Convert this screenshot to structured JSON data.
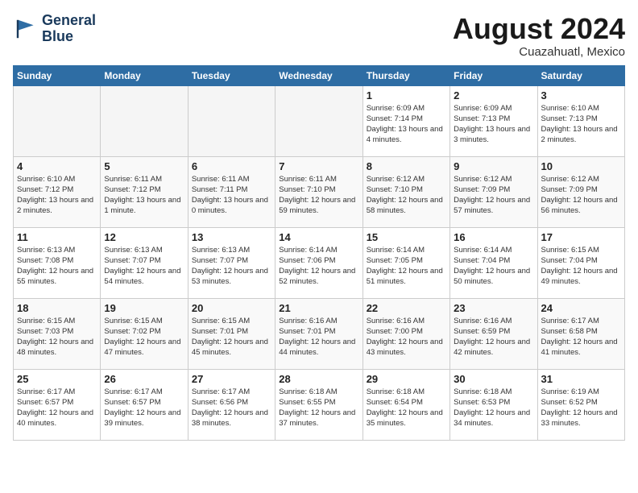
{
  "header": {
    "logo_line1": "General",
    "logo_line2": "Blue",
    "month_year": "August 2024",
    "location": "Cuazahuatl, Mexico"
  },
  "days_of_week": [
    "Sunday",
    "Monday",
    "Tuesday",
    "Wednesday",
    "Thursday",
    "Friday",
    "Saturday"
  ],
  "weeks": [
    [
      {
        "day": "",
        "empty": true
      },
      {
        "day": "",
        "empty": true
      },
      {
        "day": "",
        "empty": true
      },
      {
        "day": "",
        "empty": true
      },
      {
        "day": "1",
        "sunrise": "6:09 AM",
        "sunset": "7:14 PM",
        "daylight": "13 hours and 4 minutes."
      },
      {
        "day": "2",
        "sunrise": "6:09 AM",
        "sunset": "7:13 PM",
        "daylight": "13 hours and 3 minutes."
      },
      {
        "day": "3",
        "sunrise": "6:10 AM",
        "sunset": "7:13 PM",
        "daylight": "13 hours and 2 minutes."
      }
    ],
    [
      {
        "day": "4",
        "sunrise": "6:10 AM",
        "sunset": "7:12 PM",
        "daylight": "13 hours and 2 minutes."
      },
      {
        "day": "5",
        "sunrise": "6:11 AM",
        "sunset": "7:12 PM",
        "daylight": "13 hours and 1 minute."
      },
      {
        "day": "6",
        "sunrise": "6:11 AM",
        "sunset": "7:11 PM",
        "daylight": "13 hours and 0 minutes."
      },
      {
        "day": "7",
        "sunrise": "6:11 AM",
        "sunset": "7:10 PM",
        "daylight": "12 hours and 59 minutes."
      },
      {
        "day": "8",
        "sunrise": "6:12 AM",
        "sunset": "7:10 PM",
        "daylight": "12 hours and 58 minutes."
      },
      {
        "day": "9",
        "sunrise": "6:12 AM",
        "sunset": "7:09 PM",
        "daylight": "12 hours and 57 minutes."
      },
      {
        "day": "10",
        "sunrise": "6:12 AM",
        "sunset": "7:09 PM",
        "daylight": "12 hours and 56 minutes."
      }
    ],
    [
      {
        "day": "11",
        "sunrise": "6:13 AM",
        "sunset": "7:08 PM",
        "daylight": "12 hours and 55 minutes."
      },
      {
        "day": "12",
        "sunrise": "6:13 AM",
        "sunset": "7:07 PM",
        "daylight": "12 hours and 54 minutes."
      },
      {
        "day": "13",
        "sunrise": "6:13 AM",
        "sunset": "7:07 PM",
        "daylight": "12 hours and 53 minutes."
      },
      {
        "day": "14",
        "sunrise": "6:14 AM",
        "sunset": "7:06 PM",
        "daylight": "12 hours and 52 minutes."
      },
      {
        "day": "15",
        "sunrise": "6:14 AM",
        "sunset": "7:05 PM",
        "daylight": "12 hours and 51 minutes."
      },
      {
        "day": "16",
        "sunrise": "6:14 AM",
        "sunset": "7:04 PM",
        "daylight": "12 hours and 50 minutes."
      },
      {
        "day": "17",
        "sunrise": "6:15 AM",
        "sunset": "7:04 PM",
        "daylight": "12 hours and 49 minutes."
      }
    ],
    [
      {
        "day": "18",
        "sunrise": "6:15 AM",
        "sunset": "7:03 PM",
        "daylight": "12 hours and 48 minutes."
      },
      {
        "day": "19",
        "sunrise": "6:15 AM",
        "sunset": "7:02 PM",
        "daylight": "12 hours and 47 minutes."
      },
      {
        "day": "20",
        "sunrise": "6:15 AM",
        "sunset": "7:01 PM",
        "daylight": "12 hours and 45 minutes."
      },
      {
        "day": "21",
        "sunrise": "6:16 AM",
        "sunset": "7:01 PM",
        "daylight": "12 hours and 44 minutes."
      },
      {
        "day": "22",
        "sunrise": "6:16 AM",
        "sunset": "7:00 PM",
        "daylight": "12 hours and 43 minutes."
      },
      {
        "day": "23",
        "sunrise": "6:16 AM",
        "sunset": "6:59 PM",
        "daylight": "12 hours and 42 minutes."
      },
      {
        "day": "24",
        "sunrise": "6:17 AM",
        "sunset": "6:58 PM",
        "daylight": "12 hours and 41 minutes."
      }
    ],
    [
      {
        "day": "25",
        "sunrise": "6:17 AM",
        "sunset": "6:57 PM",
        "daylight": "12 hours and 40 minutes."
      },
      {
        "day": "26",
        "sunrise": "6:17 AM",
        "sunset": "6:57 PM",
        "daylight": "12 hours and 39 minutes."
      },
      {
        "day": "27",
        "sunrise": "6:17 AM",
        "sunset": "6:56 PM",
        "daylight": "12 hours and 38 minutes."
      },
      {
        "day": "28",
        "sunrise": "6:18 AM",
        "sunset": "6:55 PM",
        "daylight": "12 hours and 37 minutes."
      },
      {
        "day": "29",
        "sunrise": "6:18 AM",
        "sunset": "6:54 PM",
        "daylight": "12 hours and 35 minutes."
      },
      {
        "day": "30",
        "sunrise": "6:18 AM",
        "sunset": "6:53 PM",
        "daylight": "12 hours and 34 minutes."
      },
      {
        "day": "31",
        "sunrise": "6:19 AM",
        "sunset": "6:52 PM",
        "daylight": "12 hours and 33 minutes."
      }
    ]
  ],
  "labels": {
    "sunrise": "Sunrise:",
    "sunset": "Sunset:",
    "daylight": "Daylight hours"
  }
}
